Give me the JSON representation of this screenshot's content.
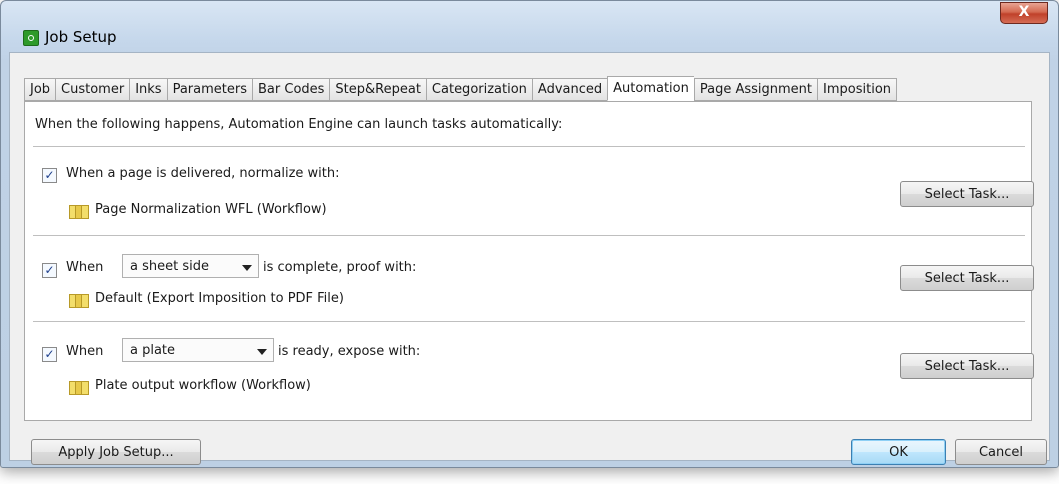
{
  "window": {
    "title": "Job Setup",
    "close_label": "X"
  },
  "tabs": [
    {
      "label": "Job",
      "active": false
    },
    {
      "label": "Customer",
      "active": false
    },
    {
      "label": "Inks",
      "active": false
    },
    {
      "label": "Parameters",
      "active": false
    },
    {
      "label": "Bar Codes",
      "active": false
    },
    {
      "label": "Step&Repeat",
      "active": false
    },
    {
      "label": "Categorization",
      "active": false
    },
    {
      "label": "Advanced",
      "active": false
    },
    {
      "label": "Automation",
      "active": true
    },
    {
      "label": "Page Assignment",
      "active": false
    },
    {
      "label": "Imposition",
      "active": false
    }
  ],
  "automation": {
    "intro": "When the following happens, Automation Engine can launch tasks automatically:",
    "rules": [
      {
        "checked": true,
        "label": "When a page is delivered, normalize with:",
        "task": "Page Normalization WFL (Workflow)",
        "button": "Select Task..."
      },
      {
        "checked": true,
        "prefix": "When",
        "select_value": "a sheet side",
        "suffix": "is complete, proof with:",
        "task": "Default (Export Imposition to PDF File)",
        "button": "Select Task..."
      },
      {
        "checked": true,
        "prefix": "When",
        "select_value": "a plate",
        "suffix": "is ready, expose with:",
        "task": "Plate output workflow (Workflow)",
        "button": "Select Task..."
      }
    ]
  },
  "footer": {
    "apply_label": "Apply Job Setup...",
    "ok_label": "OK",
    "cancel_label": "Cancel"
  },
  "check_glyph": "✓"
}
